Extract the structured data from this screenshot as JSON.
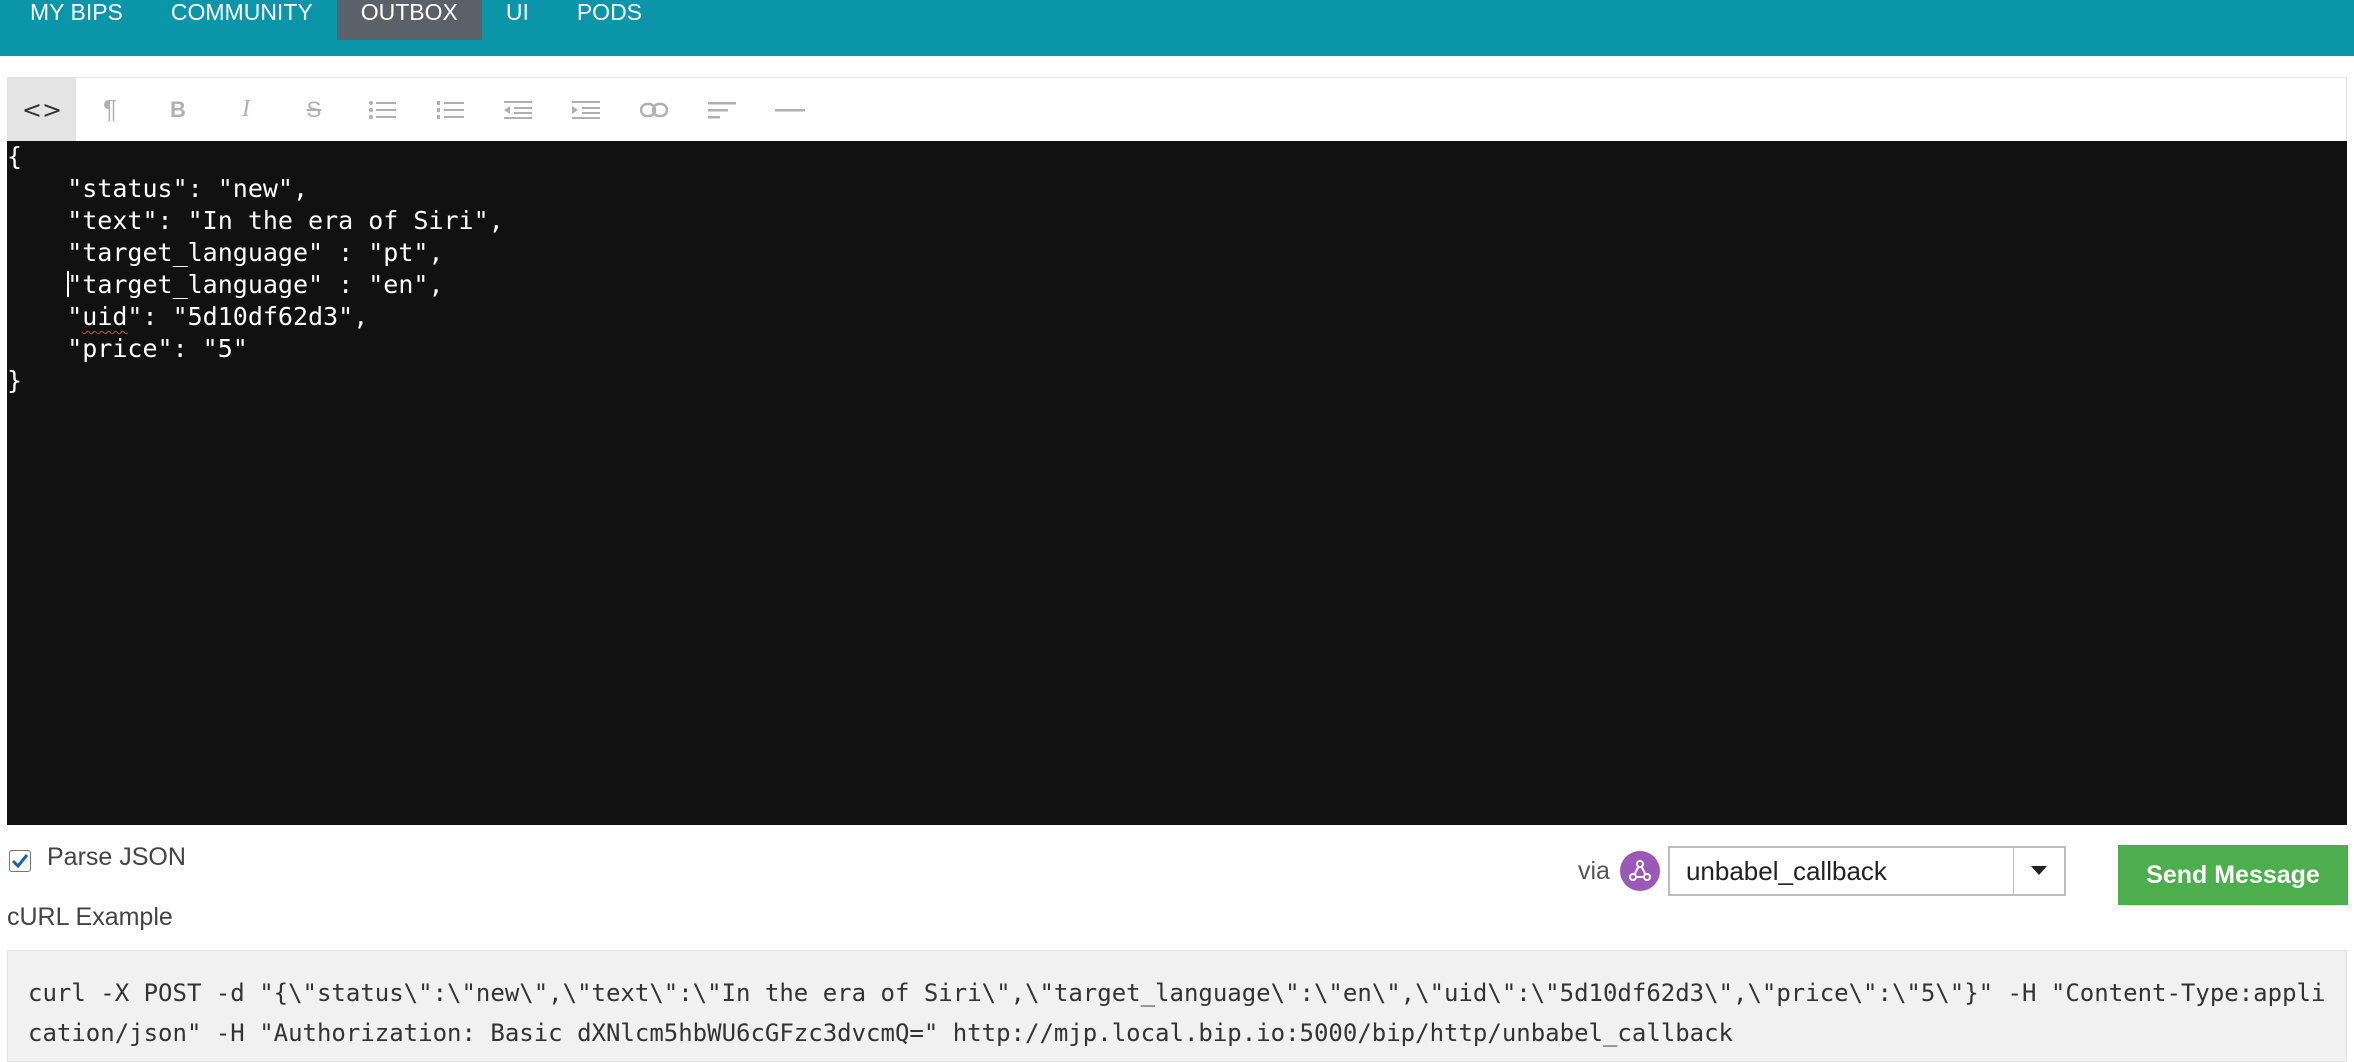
{
  "nav": {
    "items": [
      {
        "label": "MY BIPS"
      },
      {
        "label": "COMMUNITY"
      },
      {
        "label": "OUTBOX",
        "active": true
      },
      {
        "label": "UI"
      },
      {
        "label": "PODS"
      }
    ]
  },
  "toolbar": {
    "buttons": [
      {
        "name": "html-view-button",
        "icon": "code-icon",
        "active": true
      },
      {
        "name": "paragraph-button",
        "icon": "pilcrow-icon"
      },
      {
        "name": "bold-button",
        "icon": "bold-icon"
      },
      {
        "name": "italic-button",
        "icon": "italic-icon"
      },
      {
        "name": "strikethrough-button",
        "icon": "strikethrough-icon"
      },
      {
        "name": "unordered-list-button",
        "icon": "bullet-list-icon"
      },
      {
        "name": "ordered-list-button",
        "icon": "numbered-list-icon"
      },
      {
        "name": "outdent-button",
        "icon": "outdent-icon"
      },
      {
        "name": "indent-button",
        "icon": "indent-icon"
      },
      {
        "name": "link-button",
        "icon": "link-icon"
      },
      {
        "name": "align-button",
        "icon": "align-left-icon"
      },
      {
        "name": "horizontal-rule-button",
        "icon": "horizontal-rule-icon"
      }
    ]
  },
  "editor": {
    "lines": [
      "{",
      "    \"status\": \"new\",",
      "    \"text\": \"In the era of Siri\",",
      "    \"target_language\" : \"pt\",",
      "    \"target_language\" : \"en\",",
      "    \"uid\": \"5d10df62d3\",",
      "    \"price\": \"5\"",
      "}"
    ]
  },
  "parse_json": {
    "label": "Parse JSON",
    "checked": true
  },
  "via": {
    "label": "via",
    "pod_icon": "pod-share-icon",
    "selected": "unbabel_callback"
  },
  "send_button": {
    "label": "Send Message"
  },
  "curl": {
    "label": "cURL Example",
    "command": "curl -X POST -d \"{\\\"status\\\":\\\"new\\\",\\\"text\\\":\\\"In the era of Siri\\\",\\\"target_language\\\":\\\"en\\\",\\\"uid\\\":\\\"5d10df62d3\\\",\\\"price\\\":\\\"5\\\"}\" -H \"Content-Type:application/json\" -H \"Authorization: Basic dXNlcm5hbWU6cGFzc3dvcmQ=\" http://mjp.local.bip.io:5000/bip/http/unbabel_callback"
  },
  "colors": {
    "nav_bg": "#0a95a8",
    "nav_active": "#5a6168",
    "editor_bg": "#111111",
    "send_button": "#4cae4c",
    "pod_icon": "#9b59b6"
  }
}
